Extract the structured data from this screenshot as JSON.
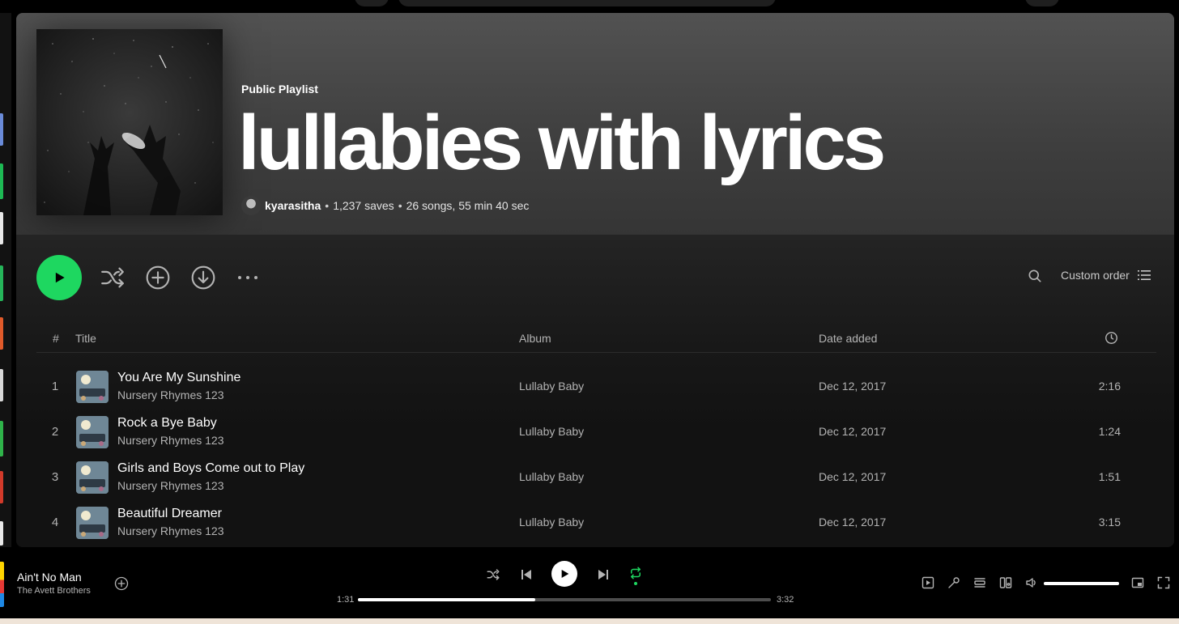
{
  "playlist": {
    "type": "Public Playlist",
    "title": "lullabies with lyrics",
    "owner": "kyarasitha",
    "saves": "1,237 saves",
    "stats": "26 songs, 55 min 40 sec"
  },
  "controls": {
    "sort_label": "Custom order"
  },
  "table": {
    "headers": {
      "num": "#",
      "title": "Title",
      "album": "Album",
      "date": "Date added"
    },
    "rows": [
      {
        "num": "1",
        "title": "You Are My Sunshine",
        "artist": "Nursery Rhymes 123",
        "album": "Lullaby Baby",
        "date": "Dec 12, 2017",
        "duration": "2:16"
      },
      {
        "num": "2",
        "title": "Rock a Bye Baby",
        "artist": "Nursery Rhymes 123",
        "album": "Lullaby Baby",
        "date": "Dec 12, 2017",
        "duration": "1:24"
      },
      {
        "num": "3",
        "title": "Girls and Boys Come out to Play",
        "artist": "Nursery Rhymes 123",
        "album": "Lullaby Baby",
        "date": "Dec 12, 2017",
        "duration": "1:51"
      },
      {
        "num": "4",
        "title": "Beautiful Dreamer",
        "artist": "Nursery Rhymes 123",
        "album": "Lullaby Baby",
        "date": "Dec 12, 2017",
        "duration": "3:15"
      }
    ]
  },
  "player": {
    "track": "Ain't No Man",
    "artist": "The Avett Brothers",
    "elapsed": "1:31",
    "total": "3:32",
    "progress_fraction": 0.43,
    "volume_fraction": 1.0
  },
  "colors": {
    "accent": "#1ed760",
    "background": "#121212"
  },
  "icons": [
    "play-icon",
    "shuffle-icon",
    "add-circle-icon",
    "download-icon",
    "more-icon",
    "search-icon",
    "list-icon",
    "clock-icon",
    "prev-icon",
    "next-icon",
    "repeat-icon",
    "now-playing-view-icon",
    "lyrics-icon",
    "queue-icon",
    "connect-device-icon",
    "volume-icon",
    "miniplayer-icon",
    "fullscreen-icon"
  ]
}
